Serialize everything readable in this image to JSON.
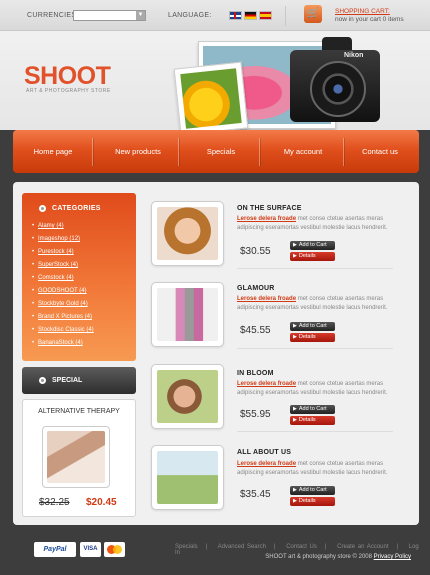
{
  "header": {
    "currencies_label": "CURRENCIES:",
    "language_label": "LANGUAGE:",
    "flags": [
      "uk",
      "de",
      "es"
    ],
    "cart_link": "SHOPPING CART:",
    "cart_status": "now in your cart 0 items"
  },
  "brand": {
    "logo": "SHOOT",
    "tagline": "ART & PHOTOGRAPHY STORE",
    "camera_brand": "Nikon"
  },
  "nav": {
    "items": [
      "Home page",
      "New products",
      "Specials",
      "My account",
      "Contact us"
    ]
  },
  "sidebar": {
    "categories_title": "CATEGORIES",
    "categories": [
      "Alamy (4)",
      "Imageshop (12)",
      "Purestock (4)",
      "SuperStock (4)",
      "Comstock (4)",
      "GOODSHOOT (4)",
      "Stockbyte Gold (4)",
      "Brand X Pictures (4)",
      "Stockdisc Classic (4)",
      "BananaStock (4)"
    ],
    "special_title": "SPECIAL",
    "promo": {
      "title": "ALTERNATIVE THERAPY",
      "old_price": "$32.25",
      "new_price": "$20.45"
    }
  },
  "products": [
    {
      "title": "ON THE SURFACE",
      "lead": "Lerose delera froade",
      "desc": "met conse ctetue asertas meras adipiscing eseramortas vestibul molestie lacus hendrerit.",
      "price": "$30.55",
      "add_label": "Add to Cart",
      "details_label": "Details"
    },
    {
      "title": "GLAMOUR",
      "lead": "Lerose delera froade",
      "desc": "met conse ctetue asertas meras adipiscing eseramortas vestibul molestie lacus hendrerit.",
      "price": "$45.55",
      "add_label": "Add to Cart",
      "details_label": "Details"
    },
    {
      "title": "IN BLOOM",
      "lead": "Lerose delera froade",
      "desc": "met conse ctetue asertas meras adipiscing eseramortas vestibul molestie lacus hendrerit.",
      "price": "$55.95",
      "add_label": "Add to Cart",
      "details_label": "Details"
    },
    {
      "title": "ALL ABOUT US",
      "lead": "Lerose delera froade",
      "desc": "met conse ctetue asertas meras adipiscing eseramortas vestibul molestie lacus hendrerit.",
      "price": "$35.45",
      "add_label": "Add to Cart",
      "details_label": "Details"
    }
  ],
  "footer": {
    "links": [
      "Specials",
      "Advanced Search",
      "Contact Us",
      "Create an Account",
      "Log In"
    ],
    "separator": "|",
    "copyright": "SHOOT art & photography store  © 2008",
    "privacy": "Privacy Policy",
    "payment": [
      "PayPal",
      "VISA",
      "MasterCard"
    ]
  },
  "colors": {
    "accent": "#e2522a",
    "nav": "#e0501d",
    "price_red": "#d03a14",
    "dark": "#3d3d3d"
  }
}
